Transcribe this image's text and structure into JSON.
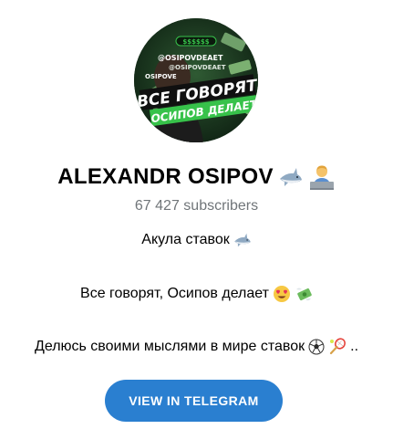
{
  "channel": {
    "name": "ALEXANDR OSIPOV",
    "name_emojis": [
      "shark-emoji",
      "man-technologist-emoji"
    ],
    "subscribers": "67 427 subscribers"
  },
  "avatar": {
    "handle_text": "@OSIPOVDEAET",
    "handle_text_2": "@OSIPOVDEAET",
    "handle_text_3": "OSIPOVE",
    "slogan_line_1": "ВСЕ ГОВОРЯТ",
    "slogan_line_2": "ОСИПОВ ДЕЛАЕТ",
    "badge": "$$$$$$",
    "colors": {
      "background": "#16311d",
      "accent": "#37c24a",
      "text": "#ffffff"
    }
  },
  "description": {
    "line1": "Акула ставок",
    "line2": "Все говорят, Осипов делает",
    "line3": "Делюсь своими мыслями в мире ставок",
    "line3_suffix": ".."
  },
  "cta": {
    "label": "VIEW IN TELEGRAM",
    "color": "#2a7fd0"
  }
}
